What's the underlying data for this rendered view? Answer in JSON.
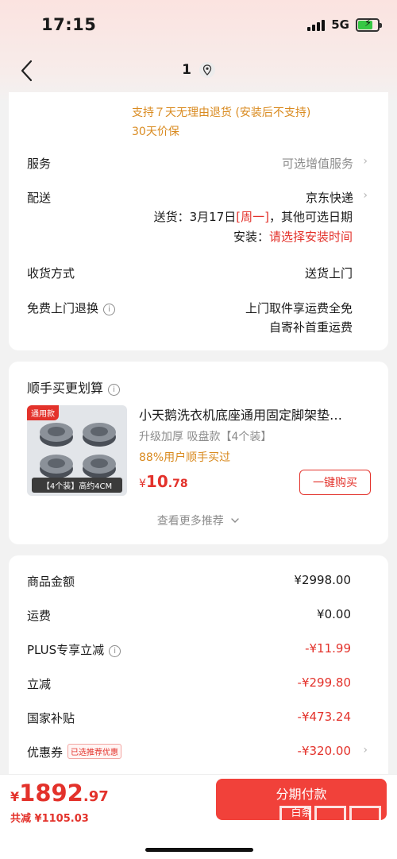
{
  "status_bar": {
    "time": "17:15",
    "network": "5G"
  },
  "nav": {
    "title": "1"
  },
  "delivery_card": {
    "return_policy": "支持７天无理由退货 (安装后不支持)",
    "price_protect": "30天价保",
    "service": {
      "label": "服务",
      "value": "可选增值服务"
    },
    "shipping": {
      "label": "配送",
      "carrier": "京东快递",
      "deliver_prefix": "送货：3月17日",
      "deliver_weekday": "[周一]",
      "deliver_suffix": "，其他可选日期",
      "install_prefix": "安装：",
      "install_value": "请选择安装时间"
    },
    "receive": {
      "label": "收货方式",
      "value": "送货上门"
    },
    "free_return": {
      "label": "免费上门退换",
      "line1": "上门取件享运费全免",
      "line2": "自寄补首重运费"
    }
  },
  "recommend": {
    "title": "顺手买更划算",
    "product": {
      "tag": "通用款",
      "image_caption": "【4个装】高约4CM",
      "name": "小天鹅洗衣机底座通用固定脚架垫…",
      "spec": "升级加厚 吸盘款【4个装】",
      "social": "88%用户顺手买过",
      "price_currency": "¥",
      "price_int": "10",
      "price_dec": ".78",
      "buy_label": "一键购买"
    },
    "more_label": "查看更多推荐"
  },
  "summary": {
    "rows": [
      {
        "label": "商品金额",
        "value": "¥2998.00"
      },
      {
        "label": "运费",
        "value": "¥0.00"
      },
      {
        "label": "PLUS专享立减",
        "value": "-¥11.99"
      },
      {
        "label": "立减",
        "value": "-¥299.80"
      },
      {
        "label": "国家补贴",
        "value": "-¥473.24"
      },
      {
        "label": "优惠券",
        "value": "-¥320.00",
        "badge": "已选推荐优惠"
      }
    ]
  },
  "bottom": {
    "total_currency": "¥",
    "total_int": "1892",
    "total_dec": ".97",
    "saved": "共减 ¥1105.03",
    "pay_label": "分期付款",
    "pay_sub": "白条"
  },
  "watermark": {
    "text": "zhizhizhi.com"
  },
  "colors": {
    "accent_red": "#e3322b",
    "orange": "#d98a1f",
    "pay_button": "#f1413a"
  }
}
